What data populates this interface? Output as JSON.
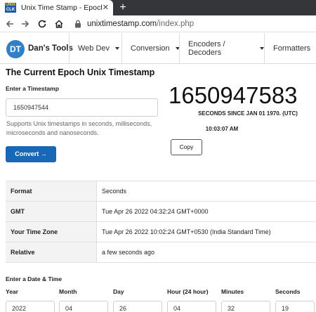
{
  "browser": {
    "tab_title": "Unix Time Stamp - Epoch Conve",
    "tab_close": "✕",
    "new_tab": "+",
    "url_host": "unixtimestamp.com",
    "url_path": "/index.php",
    "favicon_text_top": "UNIX",
    "favicon_text_bottom": "CLK"
  },
  "site": {
    "logo_initials": "DT",
    "name": "Dan's Tools",
    "menus": [
      "Web Dev",
      "Conversion",
      "Encoders / Decoders",
      "Formatters"
    ]
  },
  "main": {
    "title": "The Current Epoch Unix Timestamp",
    "enter_label": "Enter a Timestamp",
    "timestamp_value": "1650947544",
    "help_text": "Supports Unix timestamps in seconds, milliseconds, microseconds and nanoseconds.",
    "convert_label": "Convert →",
    "current_epoch": "1650947583",
    "epoch_caption": "SECONDS SINCE JAN 01 1970. (UTC)",
    "current_time": "10:03:07 AM",
    "copy_label": "Copy"
  },
  "results": [
    {
      "key": "Format",
      "value": "Seconds"
    },
    {
      "key": "GMT",
      "value": "Tue Apr 26 2022 04:32:24 GMT+0000"
    },
    {
      "key": "Your Time Zone",
      "value": "Tue Apr 26 2022 10:02:24 GMT+0530 (India Standard Time)"
    },
    {
      "key": "Relative",
      "value": "a few seconds ago"
    }
  ],
  "datetime": {
    "label": "Enter a Date & Time",
    "fields": [
      {
        "label": "Year",
        "value": "2022"
      },
      {
        "label": "Month",
        "value": "04"
      },
      {
        "label": "Day",
        "value": "26"
      },
      {
        "label": "Hour (24 hour)",
        "value": "04"
      },
      {
        "label": "Minutes",
        "value": "32"
      },
      {
        "label": "Seconds",
        "value": "19"
      }
    ]
  },
  "colors": {
    "primary_button": "#1868b7",
    "logo": "#2f80c8",
    "chrome_dark": "#35363a"
  }
}
